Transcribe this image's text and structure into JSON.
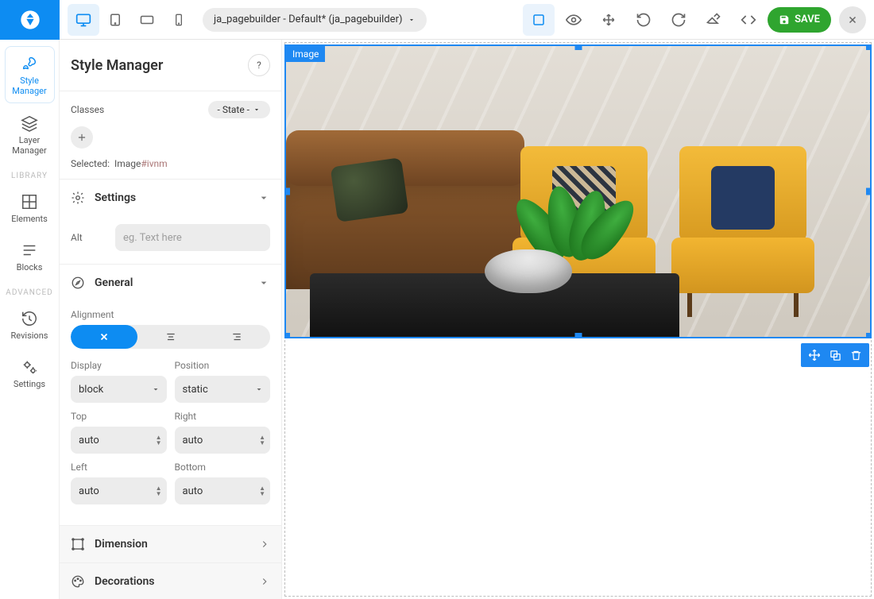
{
  "topbar": {
    "page_selector": "ja_pagebuilder - Default* (ja_pagebuilder)",
    "save_label": "SAVE"
  },
  "rail": {
    "style_manager": "Style Manager",
    "layer_manager": "Layer Manager",
    "library_label": "LIBRARY",
    "elements": "Elements",
    "blocks": "Blocks",
    "advanced_label": "ADVANCED",
    "revisions": "Revisions",
    "settings": "Settings"
  },
  "panel": {
    "title": "Style Manager",
    "help": "?",
    "classes_label": "Classes",
    "state_label": "- State -",
    "selected_label": "Selected:",
    "selected_type": "Image",
    "selected_id": "#ivnm",
    "sections": {
      "settings": {
        "title": "Settings",
        "alt_label": "Alt",
        "alt_placeholder": "eg. Text here"
      },
      "general": {
        "title": "General",
        "alignment_label": "Alignment",
        "display_label": "Display",
        "display_value": "block",
        "position_label": "Position",
        "position_value": "static",
        "top_label": "Top",
        "top_value": "auto",
        "right_label": "Right",
        "right_value": "auto",
        "left_label": "Left",
        "left_value": "auto",
        "bottom_label": "Bottom",
        "bottom_value": "auto"
      },
      "dimension": {
        "title": "Dimension"
      },
      "decorations": {
        "title": "Decorations"
      }
    }
  },
  "canvas": {
    "selection_tag": "Image"
  }
}
